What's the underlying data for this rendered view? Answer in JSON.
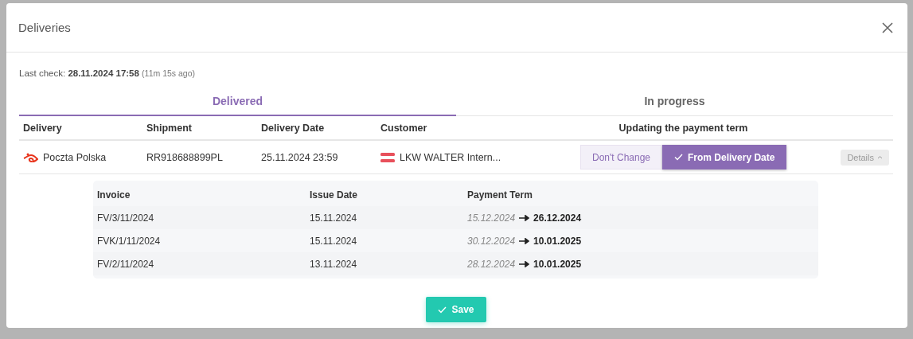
{
  "dialog": {
    "title": "Deliveries"
  },
  "last_check": {
    "label": "Last check:",
    "datetime": "28.11.2024 17:58",
    "ago": "(11m 15s ago)"
  },
  "tabs": [
    {
      "label": "Delivered",
      "selected": true
    },
    {
      "label": "In progress",
      "selected": false
    }
  ],
  "table": {
    "columns": [
      "Delivery",
      "Shipment",
      "Delivery Date",
      "Customer",
      "Updating the payment term"
    ],
    "rows": [
      {
        "carrier": "Poczta Polska",
        "shipment": "RR918688899PL",
        "delivery_date": "25.11.2024 23:59",
        "customer": "LKW WALTER Intern...",
        "payment_options": [
          {
            "label": "Don't Change",
            "selected": false
          },
          {
            "label": "From Delivery Date",
            "selected": true
          }
        ],
        "details": {
          "label": "Details",
          "expanded": true
        },
        "invoices": {
          "columns": [
            "Invoice",
            "Issue Date",
            "Payment Term"
          ],
          "rows": [
            {
              "invoice": "FV/3/11/2024",
              "issue_date": "15.11.2024",
              "old_term": "15.12.2024",
              "new_term": "26.12.2024"
            },
            {
              "invoice": "FVK/1/11/2024",
              "issue_date": "15.11.2024",
              "old_term": "30.12.2024",
              "new_term": "10.01.2025"
            },
            {
              "invoice": "FV/2/11/2024",
              "issue_date": "13.11.2024",
              "old_term": "28.12.2024",
              "new_term": "10.01.2025"
            }
          ]
        }
      }
    ]
  },
  "save_button": {
    "label": "Save"
  }
}
